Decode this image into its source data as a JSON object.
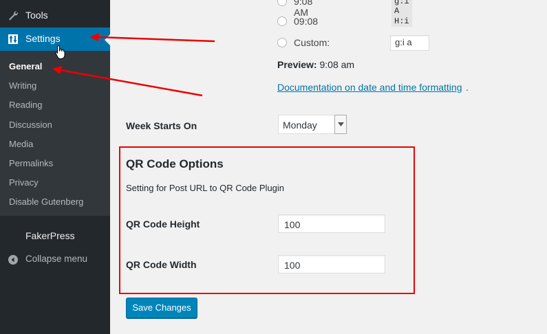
{
  "sidebar": {
    "tools_label": "Tools",
    "settings_label": "Settings",
    "submenu": [
      "General",
      "Writing",
      "Reading",
      "Discussion",
      "Media",
      "Permalinks",
      "Privacy",
      "Disable Gutenberg"
    ],
    "current": "General",
    "fakerpress_label": "FakerPress",
    "collapse_label": "Collapse menu"
  },
  "time_format": {
    "options": [
      {
        "label": "9:08 AM",
        "code": "g:i A"
      },
      {
        "label": "09:08",
        "code": "H:i"
      }
    ],
    "custom_label": "Custom:",
    "custom_value": "g:i a",
    "preview_label": "Preview:",
    "preview_value": "9:08 am",
    "doc_link": "Documentation on date and time formatting",
    "doc_link_suffix": "."
  },
  "week_starts": {
    "label": "Week Starts On",
    "value": "Monday"
  },
  "qr_section": {
    "title": "QR Code Options",
    "description": "Setting for Post URL to QR Code Plugin",
    "height_label": "QR Code Height",
    "height_value": "100",
    "width_label": "QR Code Width",
    "width_value": "100"
  },
  "save_button": "Save Changes",
  "colors": {
    "sidebar_bg": "#23282d",
    "submenu_bg": "#32373c",
    "active_blue": "#0073aa",
    "button_blue": "#0085ba",
    "annotation_red": "#e00000"
  }
}
